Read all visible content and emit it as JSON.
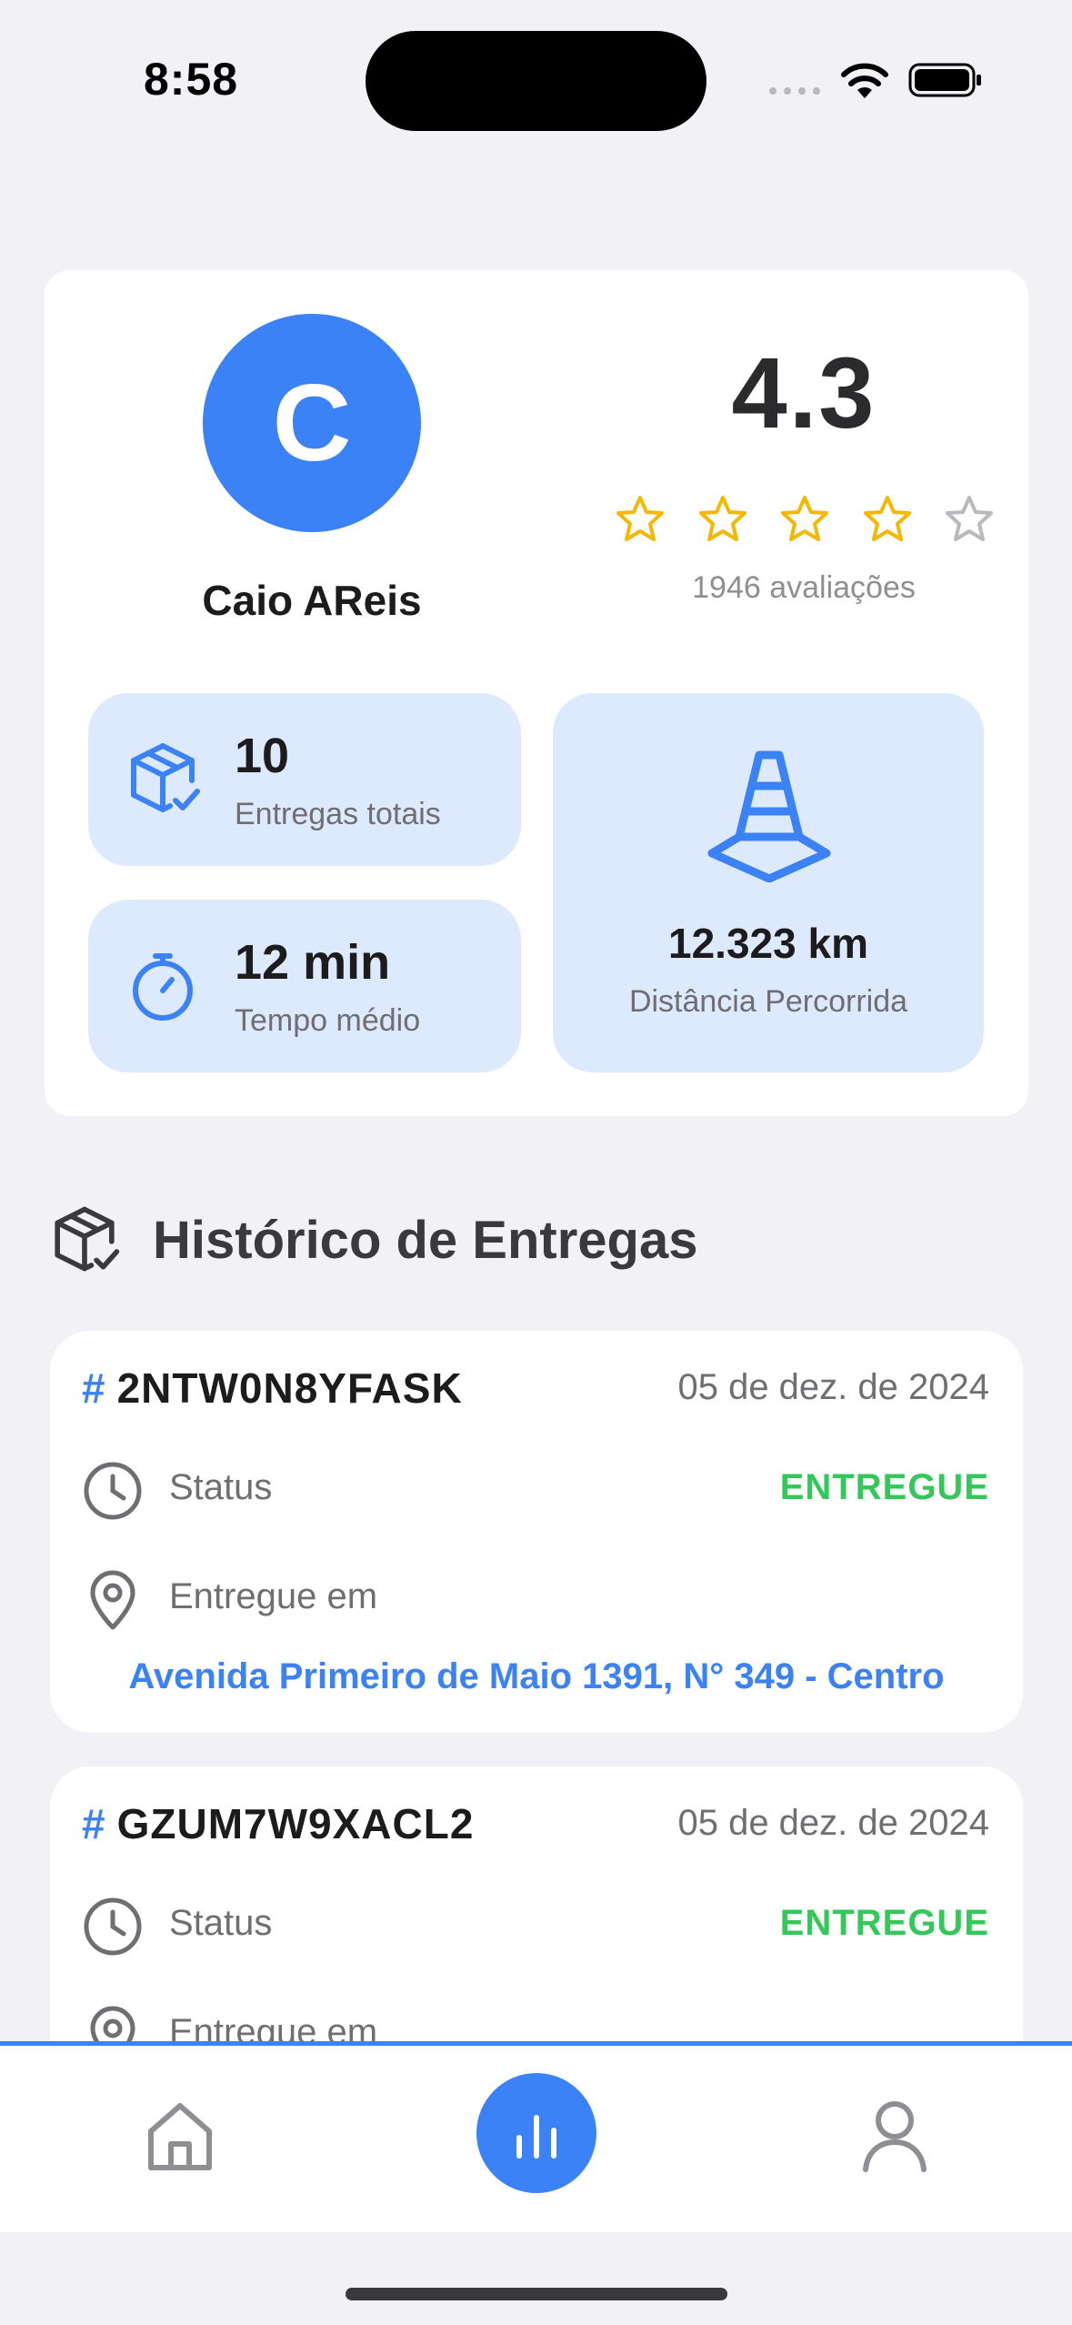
{
  "status_bar": {
    "time": "8:58"
  },
  "profile": {
    "avatar_letter": "C",
    "name": "Caio AReis",
    "rating": "4.3",
    "stars_filled": 4,
    "stars_total": 5,
    "reviews": "1946 avaliações"
  },
  "stats": {
    "deliveries": {
      "value": "10",
      "label": "Entregas totais",
      "icon": "package-check-icon"
    },
    "avg_time": {
      "value": "12 min",
      "label": "Tempo médio",
      "icon": "stopwatch-icon"
    },
    "distance": {
      "value": "12.323 km",
      "label": "Distância Percorrida",
      "icon": "traffic-cone-icon"
    }
  },
  "history": {
    "title": "Histórico de Entregas",
    "hash": "#",
    "deliveries": [
      {
        "id": "2NTW0N8YFASK",
        "date": "05 de dez. de 2024",
        "status_label": "Status",
        "status": "ENTREGUE",
        "location_label": "Entregue em",
        "address": "Avenida Primeiro de Maio 1391, N° 349 - Centro"
      },
      {
        "id": "GZUM7W9XACL2",
        "date": "05 de dez. de 2024",
        "status_label": "Status",
        "status": "ENTREGUE",
        "location_label": "Entregue em",
        "address": ""
      }
    ]
  },
  "tabbar": {
    "items": [
      "home-icon",
      "bar-chart-icon",
      "user-icon"
    ],
    "active": 1
  },
  "colors": {
    "accent": "#3b82f6",
    "success": "#34c759",
    "star": "#f5b800",
    "stat_bg": "#dde9fc"
  }
}
